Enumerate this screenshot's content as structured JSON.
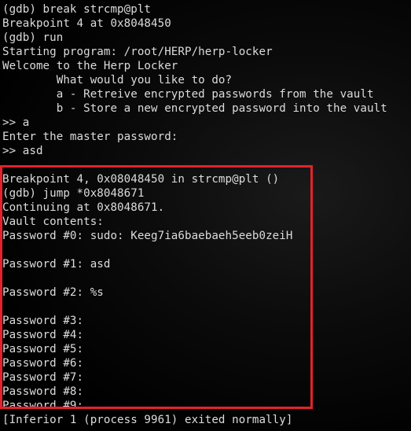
{
  "terminal": {
    "lines": [
      "(gdb) break strcmp@plt",
      "Breakpoint 4 at 0x8048450",
      "(gdb) run",
      "Starting program: /root/HERP/herp-locker",
      "Welcome to the Herp Locker",
      "        What would you like to do?",
      "        a - Retreive encrypted passwords from the vault",
      "        b - Store a new encrypted password into the vault",
      ">> a",
      "Enter the master password:",
      ">> asd",
      "",
      "Breakpoint 4, 0x08048450 in strcmp@plt ()",
      "(gdb) jump *0x8048671",
      "Continuing at 0x8048671.",
      "Vault contents:",
      "Password #0: sudo: Keeg7ia6baebaeh5eeb0zeiH",
      "",
      "Password #1: asd",
      "",
      "Password #2: %s",
      "",
      "Password #3:",
      "Password #4:",
      "Password #5:",
      "Password #6:",
      "Password #7:",
      "Password #8:",
      "Password #9:",
      "[Inferior 1 (process 9961) exited normally]"
    ]
  },
  "colors": {
    "text": "#dcdcdc",
    "background": "#000000",
    "highlight": "#e4222b"
  }
}
